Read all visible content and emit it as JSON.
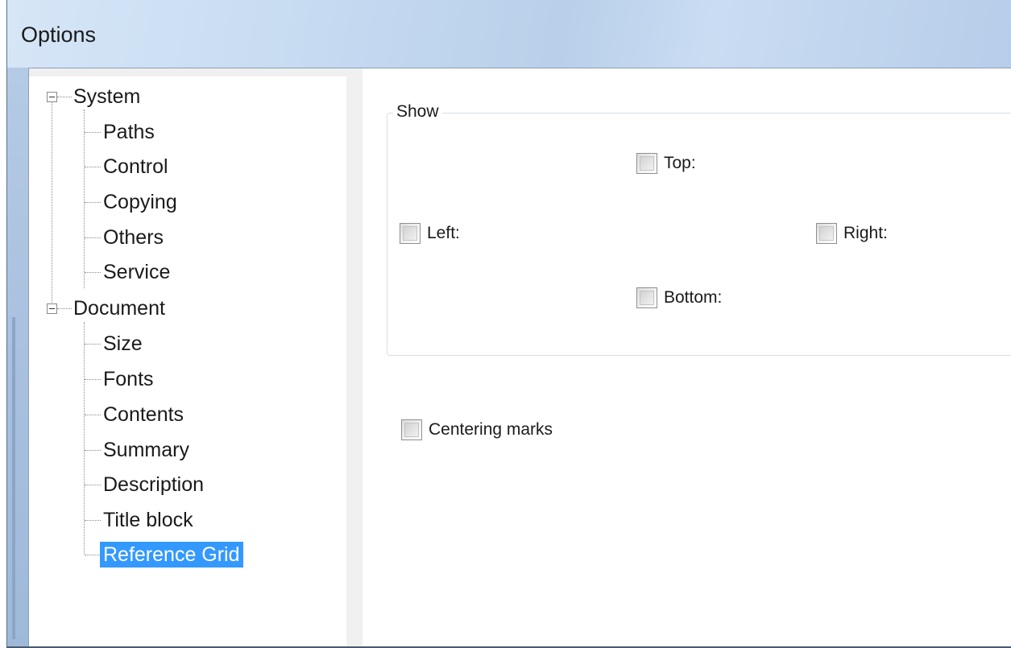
{
  "window": {
    "title": "Options"
  },
  "tree": {
    "groups": [
      {
        "label": "System",
        "children": [
          "Paths",
          "Control",
          "Copying",
          "Others",
          "Service"
        ]
      },
      {
        "label": "Document",
        "children": [
          "Size",
          "Fonts",
          "Contents",
          "Summary",
          "Description",
          "Title block",
          "Reference Grid"
        ]
      }
    ],
    "selected": "Reference Grid"
  },
  "panel": {
    "show_group": {
      "legend": "Show",
      "top": {
        "label": "Top:",
        "checked": false
      },
      "left": {
        "label": "Left:",
        "checked": false
      },
      "right": {
        "label": "Right:",
        "checked": false
      },
      "bottom": {
        "label": "Bottom:",
        "checked": false
      }
    },
    "centering_marks": {
      "label": "Centering marks",
      "checked": false
    }
  }
}
